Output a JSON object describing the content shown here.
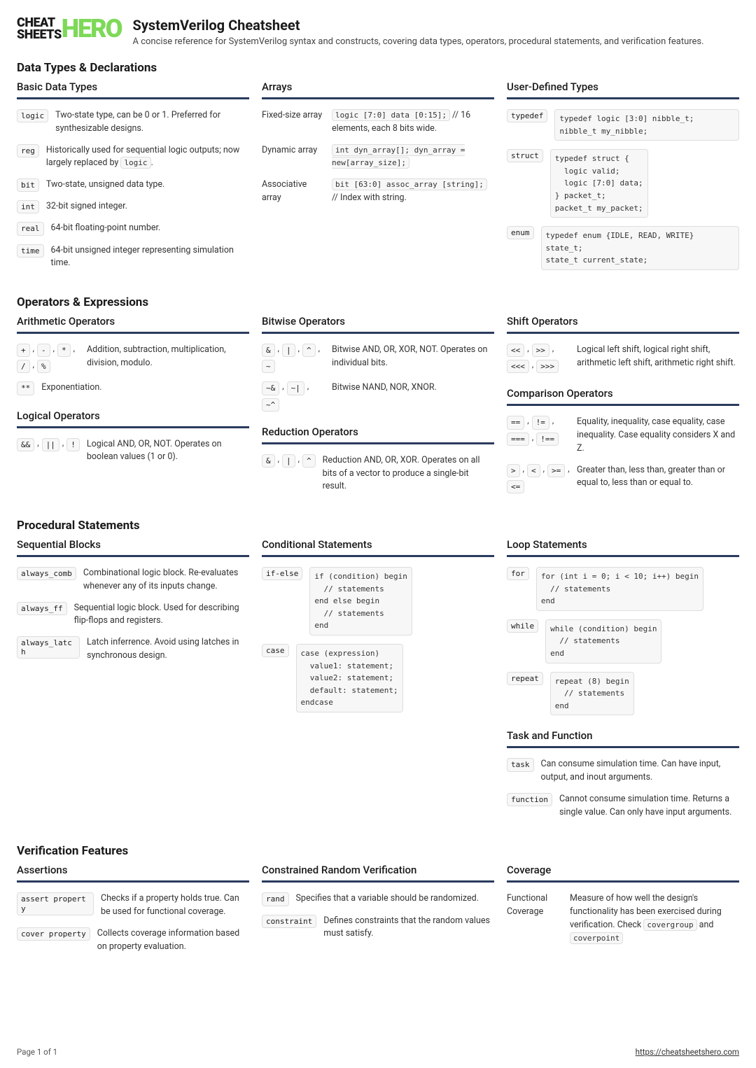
{
  "logo": {
    "line1": "CHEAT",
    "line2": "SHEETS",
    "hero": "HERO"
  },
  "title": "SystemVerilog Cheatsheet",
  "subtitle": "A concise reference for SystemVerilog syntax and constructs, covering data types, operators, procedural statements, and verification features.",
  "sections": {
    "dataTypes": {
      "title": "Data Types & Declarations",
      "basic": {
        "title": "Basic Data Types",
        "items": [
          {
            "key": [
              "logic"
            ],
            "desc": "Two-state type, can be 0 or 1. Preferred for synthesizable designs."
          },
          {
            "key": [
              "reg"
            ],
            "desc_pre": "Historically used for sequential logic outputs; now largely replaced by ",
            "inline": "logic",
            "desc_post": "."
          },
          {
            "key": [
              "bit"
            ],
            "desc": "Two-state, unsigned data type."
          },
          {
            "key": [
              "int"
            ],
            "desc": "32-bit signed integer."
          },
          {
            "key": [
              "real"
            ],
            "desc": "64-bit floating-point number."
          },
          {
            "key": [
              "time"
            ],
            "desc": "64-bit unsigned integer representing simulation time."
          }
        ]
      },
      "arrays": {
        "title": "Arrays",
        "items": [
          {
            "label": "Fixed-size array",
            "code": "logic [7:0] data [0:15];",
            "trail": " // 16 elements, each 8 bits wide."
          },
          {
            "label": "Dynamic array",
            "code": "int dyn_array[]; dyn_array = new[array_size];"
          },
          {
            "label": "Associative array",
            "code": "bit [63:0] assoc_array [string];",
            "trail": " // Index with string."
          }
        ]
      },
      "udt": {
        "title": "User-Defined Types",
        "items": [
          {
            "key": [
              "typedef"
            ],
            "code": "typedef logic [3:0] nibble_t;  nibble_t my_nibble;"
          },
          {
            "key": [
              "struct"
            ],
            "code": "typedef struct {\n  logic valid;\n  logic [7:0] data;\n} packet_t;\npacket_t my_packet;"
          },
          {
            "key": [
              "enum"
            ],
            "code": "typedef enum {IDLE, READ, WRITE} state_t;\nstate_t current_state;"
          }
        ]
      }
    },
    "operators": {
      "title": "Operators & Expressions",
      "arith": {
        "title": "Arithmetic Operators",
        "items": [
          {
            "key": [
              "+",
              "-",
              "*",
              "/",
              "%"
            ],
            "desc": "Addition, subtraction, multiplication, division, modulo."
          },
          {
            "key": [
              "**"
            ],
            "desc": "Exponentiation."
          }
        ]
      },
      "logical": {
        "title": "Logical Operators",
        "items": [
          {
            "key": [
              "&&",
              "||",
              "!"
            ],
            "desc": "Logical AND, OR, NOT. Operates on boolean values (1 or 0)."
          }
        ]
      },
      "bitwise": {
        "title": "Bitwise Operators",
        "items": [
          {
            "key": [
              "&",
              "|",
              "^",
              "~"
            ],
            "desc": "Bitwise AND, OR, XOR, NOT. Operates on individual bits."
          },
          {
            "key": [
              "~&",
              "~|",
              "~^"
            ],
            "desc": "Bitwise NAND, NOR, XNOR."
          }
        ]
      },
      "reduction": {
        "title": "Reduction Operators",
        "items": [
          {
            "key": [
              "&",
              "|",
              "^"
            ],
            "desc": "Reduction AND, OR, XOR. Operates on all bits of a vector to produce a single-bit result."
          }
        ]
      },
      "shift": {
        "title": "Shift Operators",
        "items": [
          {
            "key": [
              "<<",
              ">>",
              "<<<",
              ">>>"
            ],
            "desc": "Logical left shift, logical right shift, arithmetic left shift, arithmetic right shift."
          }
        ]
      },
      "comparison": {
        "title": "Comparison Operators",
        "items": [
          {
            "key": [
              "==",
              "!=",
              "===",
              "!=="
            ],
            "desc": "Equality, inequality, case equality, case inequality. Case equality considers X and Z."
          },
          {
            "key": [
              ">",
              "<",
              ">=",
              "<="
            ],
            "desc": "Greater than, less than, greater than or equal to, less than or equal to."
          }
        ]
      }
    },
    "procedural": {
      "title": "Procedural Statements",
      "sequential": {
        "title": "Sequential Blocks",
        "items": [
          {
            "key": [
              "always_comb"
            ],
            "desc": "Combinational logic block. Re-evaluates whenever any of its inputs change."
          },
          {
            "key": [
              "always_ff"
            ],
            "desc": "Sequential logic block. Used for describing flip-flops and registers."
          },
          {
            "key": [
              "always_latch"
            ],
            "desc": "Latch inferrence. Avoid using latches in synchronous design."
          }
        ]
      },
      "conditional": {
        "title": "Conditional Statements",
        "items": [
          {
            "key": [
              "if-else"
            ],
            "code": "if (condition) begin\n  // statements\nend else begin\n  // statements\nend"
          },
          {
            "key": [
              "case"
            ],
            "code": "case (expression)\n  value1: statement;\n  value2: statement;\n  default: statement;\nendcase"
          }
        ]
      },
      "loop": {
        "title": "Loop Statements",
        "items": [
          {
            "key": [
              "for"
            ],
            "code": "for (int i = 0; i < 10; i++) begin\n  // statements\nend"
          },
          {
            "key": [
              "while"
            ],
            "code": "while (condition) begin\n  // statements\nend"
          },
          {
            "key": [
              "repeat"
            ],
            "code": "repeat (8) begin\n  // statements\nend"
          }
        ]
      },
      "taskfn": {
        "title": "Task and Function",
        "items": [
          {
            "key": [
              "task"
            ],
            "desc": "Can consume simulation time. Can have input, output, and inout arguments."
          },
          {
            "key": [
              "function"
            ],
            "desc": "Cannot consume simulation time. Returns a single value. Can only have input arguments."
          }
        ]
      }
    },
    "verification": {
      "title": "Verification Features",
      "assertions": {
        "title": "Assertions",
        "items": [
          {
            "key": [
              "assert property"
            ],
            "desc": "Checks if a property holds true. Can be used for functional coverage."
          },
          {
            "key": [
              "cover property"
            ],
            "desc": "Collects coverage information based on property evaluation."
          }
        ]
      },
      "crv": {
        "title": "Constrained Random Verification",
        "items": [
          {
            "key": [
              "rand"
            ],
            "desc": "Specifies that a variable should be randomized."
          },
          {
            "key": [
              "constraint"
            ],
            "desc": "Defines constraints that the random values must satisfy."
          }
        ]
      },
      "coverage": {
        "title": "Coverage",
        "items": [
          {
            "label": "Functional Coverage",
            "desc_pre": "Measure of how well the design's functionality has been exercised during verification. Check ",
            "inline1": "covergroup",
            "mid": " and ",
            "inline2": "coverpoint"
          }
        ]
      }
    }
  },
  "footer": {
    "page": "Page 1 of 1",
    "url": "https://cheatsheetshero.com"
  }
}
